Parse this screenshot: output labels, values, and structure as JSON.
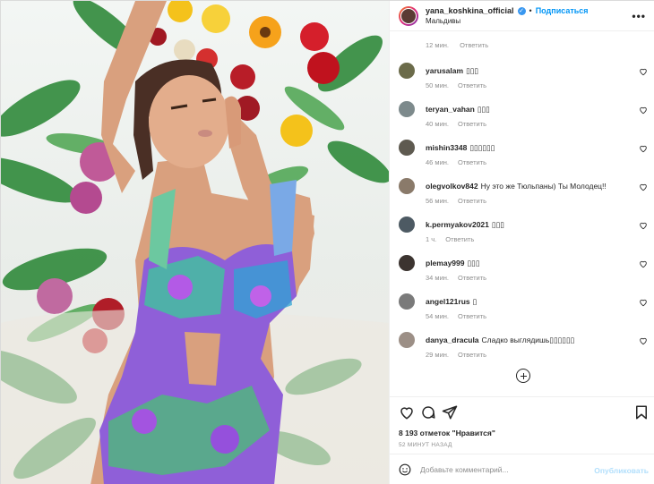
{
  "post": {
    "username": "yana_koshkina_official",
    "verified_icon": "verified-badge-icon",
    "separator": "•",
    "follow_label": "Подписаться",
    "location": "Мальдивы",
    "more_icon": "more-options-icon"
  },
  "comments": {
    "partial_top": {
      "time": "12 мин.",
      "reply": "Ответить"
    },
    "items": [
      {
        "user": "yarusalam",
        "text": "▯▯▯",
        "time": "50 мин.",
        "reply": "Ответить"
      },
      {
        "user": "teryan_vahan",
        "text": "▯▯▯",
        "time": "40 мин.",
        "reply": "Ответить"
      },
      {
        "user": "mishin3348",
        "text": "▯▯▯▯▯▯",
        "time": "46 мин.",
        "reply": "Ответить"
      },
      {
        "user": "olegvolkov842",
        "text": "Ну это же Тюльпаны) Ты Молодец!!",
        "time": "56 мин.",
        "reply": "Ответить"
      },
      {
        "user": "k.permyakov2021",
        "text": "▯▯▯",
        "time": "1 ч.",
        "reply": "Ответить"
      },
      {
        "user": "plemay999",
        "text": "▯▯▯",
        "time": "34 мин.",
        "reply": "Ответить"
      },
      {
        "user": "angel121rus",
        "text": "▯",
        "time": "54 мин.",
        "reply": "Ответить"
      },
      {
        "user": "danya_dracula",
        "text": "Сладко выглядишь▯▯▯▯▯▯",
        "time": "29 мин.",
        "reply": "Ответить"
      }
    ],
    "load_more_icon": "plus-circle-icon"
  },
  "actions": {
    "like_icon": "heart-icon",
    "comment_icon": "comment-icon",
    "share_icon": "paper-plane-icon",
    "save_icon": "bookmark-icon",
    "likes_text": "8 193 отметок \"Нравится\"",
    "time_ago": "52 МИНУТ НАЗАД"
  },
  "add_comment": {
    "emoji_icon": "smiley-icon",
    "placeholder": "Добавьте комментарий...",
    "publish_label": "Опубликовать"
  },
  "colors": {
    "accent": "#0095f6",
    "publish_disabled": "#b2dffc",
    "muted": "#8e8e8e",
    "text": "#262626"
  }
}
